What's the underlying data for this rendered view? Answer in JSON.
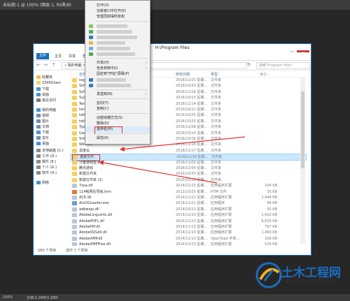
{
  "ps": {
    "tab_title": "未标题-1 @ 100% (图层 1, RGB/8)",
    "close_glyph": "×",
    "zoom": "100%",
    "doc_info": "文档:3.28M/3.28M"
  },
  "explorer": {
    "title": "H:\\Program Files",
    "file_tab": "文件",
    "ribbon_tabs": [
      "主页",
      "共享",
      "查看"
    ],
    "nav_back": "←",
    "nav_forward": "→",
    "nav_up": "↑",
    "address": "« 我的电脑 > 本地磁盘 (H:) > Program Files",
    "refresh": "↻",
    "search_placeholder": "搜索\"Program Files\"",
    "columns": {
      "name": "名称",
      "date": "修改日期",
      "type": "类型",
      "size": "大小"
    },
    "nav_items": [
      {
        "label": "收藏夹",
        "icon": "star-icon",
        "color": "#f0c040"
      },
      {
        "label": "2345Down",
        "icon": "folder-icon",
        "color": "#f3cf63"
      },
      {
        "label": "下载",
        "icon": "download-icon",
        "color": "#4a90d9"
      },
      {
        "label": "桌面",
        "icon": "desktop-icon",
        "color": "#4a90d9"
      },
      {
        "label": "最近访问",
        "icon": "recent-icon",
        "color": "#7a7a7a"
      },
      {
        "label": "我的电脑",
        "icon": "computer-icon",
        "color": "#4a90d9"
      },
      {
        "label": "视频",
        "icon": "video-icon",
        "color": "#6b8fb3"
      },
      {
        "label": "图片",
        "icon": "picture-icon",
        "color": "#6b8fb3"
      },
      {
        "label": "文档",
        "icon": "document-icon",
        "color": "#6b8fb3"
      },
      {
        "label": "下载",
        "icon": "download-icon",
        "color": "#4a90d9"
      },
      {
        "label": "音乐",
        "icon": "music-icon",
        "color": "#6b8fb3"
      },
      {
        "label": "桌面",
        "icon": "desktop-icon",
        "color": "#4a90d9"
      },
      {
        "label": "本地磁盘 (C:)",
        "icon": "drive-icon",
        "color": "#8a8a8a"
      },
      {
        "label": "工作 (D:)",
        "icon": "drive-icon",
        "color": "#8a8a8a"
      },
      {
        "label": "娱乐 (E:)",
        "icon": "drive-icon",
        "color": "#8a8a8a"
      },
      {
        "label": "个人 (G:)",
        "icon": "drive-icon",
        "color": "#8a8a8a"
      },
      {
        "label": "软件 (H:)",
        "icon": "drive-icon",
        "color": "#8a8a8a"
      },
      {
        "label": "网络",
        "icon": "network-icon",
        "color": "#4a90d9"
      }
    ],
    "files": [
      {
        "name": "sogou",
        "date": "2016/11/25 星期...",
        "type": "文件夹",
        "size": "",
        "color": "#f3cf63"
      },
      {
        "name": "Softw",
        "date": "2016/10/20 星期...",
        "type": "文件夹",
        "size": "",
        "color": "#f3cf63"
      },
      {
        "name": "Softw",
        "date": "2016/11/18 星期...",
        "type": "文件夹",
        "size": "",
        "color": "#f3cf63"
      },
      {
        "name": "Suppo",
        "date": "2016/10/13 星期...",
        "type": "文件夹",
        "size": "",
        "color": "#f3cf63"
      },
      {
        "name": "Tencent",
        "date": "2016/11/14 星期...",
        "type": "文件夹",
        "size": "",
        "color": "#f3cf63"
      },
      {
        "name": "tencen",
        "date": "2016/10/11 星期...",
        "type": "文件夹",
        "size": "",
        "color": "#f3cf63"
      },
      {
        "name": "tether_",
        "date": "2016/10/25 星期...",
        "type": "文件夹",
        "size": "",
        "color": "#f3cf63"
      },
      {
        "name": "tether_",
        "date": "2016/10/25 星期...",
        "type": "文件夹",
        "size": "",
        "color": "#f3cf63"
      },
      {
        "name": "Typee",
        "date": "2016/11/08 星期...",
        "type": "文件夹",
        "size": "",
        "color": "#f3cf63"
      },
      {
        "name": "Users",
        "date": "2016/10/14 星期...",
        "type": "文件夹",
        "size": "",
        "color": "#f3cf63"
      },
      {
        "name": "Video",
        "date": "2016/10/14 星期...",
        "type": "文件夹",
        "size": "",
        "color": "#f3cf63"
      },
      {
        "name": "WeGam",
        "date": "2016/11/18 星期...",
        "type": "文件夹",
        "size": "",
        "color": "#f3cf63"
      },
      {
        "name": "百度云",
        "date": "2016/11/17 星期...",
        "type": "文件夹",
        "size": "",
        "color": "#f3cf63"
      },
      {
        "name": "重要文件",
        "date": "2016/11/16 星期...",
        "type": "文件夹",
        "size": "",
        "color": "#f3cf63"
      },
      {
        "name": "斗鱼游戏盒子",
        "date": "2016/11/03 星期...",
        "type": "文件夹",
        "size": "",
        "color": "#f3cf63"
      },
      {
        "name": "腾讯游戏",
        "date": "2016/11/04 星期...",
        "type": "文件夹",
        "size": "",
        "color": "#f3cf63"
      },
      {
        "name": "新建文件夹",
        "date": "2016/10/20 星期...",
        "type": "文件夹",
        "size": "",
        "color": "#f3cf63"
      },
      {
        "name": "新建文件夹 (2)",
        "date": "2016/10/20 星期...",
        "type": "文件夹",
        "size": "",
        "color": "#f3cf63"
      },
      {
        "name": "7zxa.dll",
        "date": "2014/11/23 星期...",
        "type": "应用程序扩展",
        "size": "204 KB",
        "color": "#b9c6d6"
      },
      {
        "name": "114啦网址导航.htm",
        "date": "2012/10/25 星期...",
        "type": "HTM 文件",
        "size": "35 KB",
        "color": "#e07b39"
      },
      {
        "name": "ACE.dll",
        "date": "2014/11/21 星期...",
        "type": "应用程序扩展",
        "size": "1,944 KB",
        "color": "#b9c6d6"
      },
      {
        "name": "Ace32Loader.exe",
        "date": "2014/11/21 星期...",
        "type": "应用程序",
        "size": "96 KB",
        "color": "#6a9bd1"
      },
      {
        "name": "adbwapi.dll",
        "date": "2014/10/13 星期...",
        "type": "应用程序扩展",
        "size": "92 KB",
        "color": "#b9c6d6"
      },
      {
        "name": "AdobeLinguistic.dll",
        "date": "2014/11/13 星期...",
        "type": "应用程序扩展",
        "size": "1,410 KB",
        "color": "#b9c6d6"
      },
      {
        "name": "AdobePDFL.dll",
        "date": "2014/11/13 星期...",
        "type": "应用程序扩展",
        "size": "6,630 KB",
        "color": "#b9c6d6"
      },
      {
        "name": "AdobePIP.dll",
        "date": "2014/11/13 星期...",
        "type": "应用程序扩展",
        "size": "787 KB",
        "color": "#b9c6d6"
      },
      {
        "name": "AdobeSVGdll.dll",
        "date": "2014/11/13 星期...",
        "type": "应用程序扩展",
        "size": "1,469 KB",
        "color": "#b9c6d6"
      },
      {
        "name": "AdobeXMP.dll",
        "date": "2014/11/13 星期...",
        "type": "OpenType 字体...",
        "size": "256 KB",
        "color": "#b9c6d6"
      },
      {
        "name": "AdobeXMPFiles.dll",
        "date": "2014/11/13 星期...",
        "type": "应用程序扩展",
        "size": "526 KB",
        "color": "#b9c6d6"
      }
    ],
    "status_count": "180 个项目",
    "status_selected": "选中 1 个项目"
  },
  "context_menu": {
    "items": [
      {
        "label": "打开(O)",
        "kind": "text"
      },
      {
        "label": "在新窗口中打开(E)",
        "kind": "text"
      },
      {
        "label": "管理员取得所有权",
        "kind": "text"
      },
      {
        "kind": "sep"
      },
      {
        "kind": "blur",
        "color": "#8bc34a"
      },
      {
        "kind": "blur",
        "color": "#4caf50"
      },
      {
        "kind": "blur",
        "color": "#2e7dbb"
      },
      {
        "kind": "blur",
        "color": "#f2b44b"
      },
      {
        "kind": "blur",
        "color": "#6fb3e0"
      },
      {
        "kind": "blur",
        "color": "#4caf50"
      },
      {
        "kind": "sep"
      },
      {
        "label": "共享(H)",
        "kind": "text",
        "arrow": true
      },
      {
        "label": "包含到库中(I)",
        "kind": "text",
        "arrow": true
      },
      {
        "label": "固定到\"开始\"屏幕(P)",
        "kind": "text"
      },
      {
        "kind": "blur",
        "color": "#2e7dbb"
      },
      {
        "kind": "blur",
        "color": "#2e7dbb"
      },
      {
        "kind": "sep"
      },
      {
        "label": "发送到(N)",
        "kind": "text",
        "arrow": true
      },
      {
        "kind": "sep"
      },
      {
        "label": "剪切(T)",
        "kind": "text"
      },
      {
        "label": "复制(C)",
        "kind": "text"
      },
      {
        "kind": "sep"
      },
      {
        "label": "创建快捷方式(S)",
        "kind": "text"
      },
      {
        "label": "删除(D)",
        "kind": "text"
      },
      {
        "label": "重命名(M)",
        "kind": "text",
        "highlight": true
      },
      {
        "kind": "sep"
      },
      {
        "label": "属性(R)",
        "kind": "text"
      }
    ]
  },
  "watermark": {
    "brand": "土木工程网",
    "url": "www.civilcn.com"
  },
  "colors": {
    "accent_blue": "#1e6fb8",
    "selection": "#cce8ff",
    "annotation_red": "#e23030",
    "folder_yellow": "#f3cf63"
  }
}
